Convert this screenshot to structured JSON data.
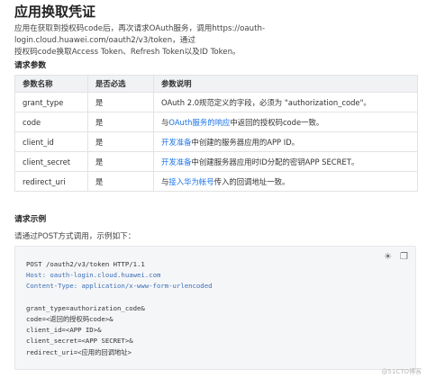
{
  "title": "应用换取凭证",
  "intro_line1": "应用在获取到授权码code后，再次请求OAuth服务，调用https://oauth-login.cloud.huawei.com/oauth2/v3/token，通过",
  "intro_line2": "授权码code换取Access Token、Refresh Token以及ID Token。",
  "params_heading": "请求参数",
  "table": {
    "headers": [
      "参数名称",
      "是否必选",
      "参数说明"
    ],
    "rows": [
      {
        "name": "grant_type",
        "required": "是",
        "desc_pre": "OAuth 2.0规范定义的字段，必须为 \"authorization_code\"。",
        "desc_link": "",
        "desc_post": ""
      },
      {
        "name": "code",
        "required": "是",
        "desc_pre": "与",
        "desc_link": "OAuth服务的响应",
        "desc_post": "中返回的授权码code一致。"
      },
      {
        "name": "client_id",
        "required": "是",
        "desc_pre": "",
        "desc_link": "开发准备",
        "desc_post": "中创建的服务器应用的APP ID。"
      },
      {
        "name": "client_secret",
        "required": "是",
        "desc_pre": "",
        "desc_link": "开发准备",
        "desc_post": "中创建服务器应用时ID分配的密钥APP SECRET。"
      },
      {
        "name": "redirect_uri",
        "required": "是",
        "desc_pre": "与",
        "desc_link": "接入华为帐号",
        "desc_post": "传入的回调地址一致。"
      }
    ]
  },
  "example_heading": "请求示例",
  "call_text": "请通过POST方式调用，示例如下：",
  "code": {
    "line1": "POST /oauth2/v3/token HTTP/1.1",
    "line2": "Host: oauth-login.cloud.huawei.com",
    "line3": "Content-Type: application/x-www-form-urlencoded",
    "line4": "grant_type=authorization_code&",
    "line5": "code=<返回的授权码code>&",
    "line6": "client_id=<APP ID>&",
    "line7": "client_secret=<APP SECRET>&",
    "line8": "redirect_uri=<应用的回调地址>"
  },
  "toolbar": {
    "theme_icon": "☀",
    "copy_icon": "❐"
  },
  "watermark": "@51CTO博客"
}
